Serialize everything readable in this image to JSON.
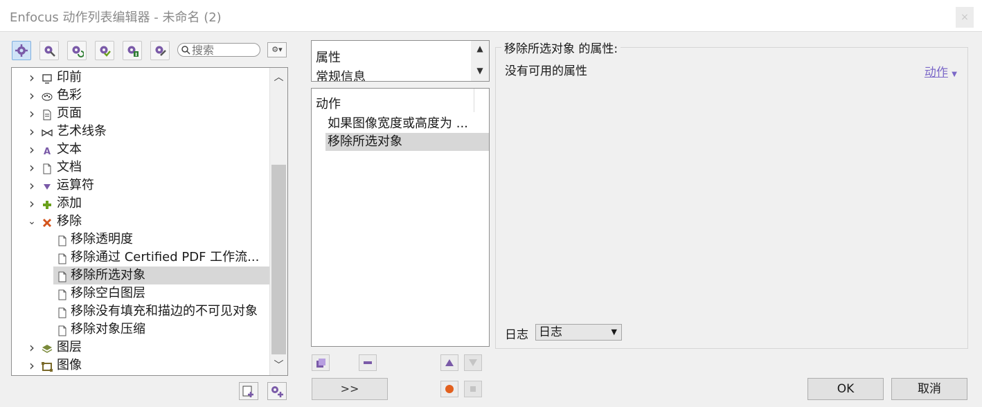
{
  "window": {
    "title": "Enfocus 动作列表编辑器 - 未命名 (2)",
    "close_glyph": "×"
  },
  "toolbar": {
    "tools": [
      "gear-icon",
      "gear-wrench-icon",
      "gear-refresh-icon",
      "gear-check-icon",
      "gear-info-icon",
      "gear-pencil-icon"
    ],
    "search_placeholder": "搜索",
    "gear_dropdown_label": "⚙▾"
  },
  "tree": {
    "items": [
      {
        "label": "印前",
        "icon": "monitor-icon",
        "expanded": false,
        "level": 0
      },
      {
        "label": "色彩",
        "icon": "palette-icon",
        "expanded": false,
        "level": 0
      },
      {
        "label": "页面",
        "icon": "page-icon",
        "expanded": false,
        "level": 0
      },
      {
        "label": "艺术线条",
        "icon": "bowtie-icon",
        "expanded": false,
        "level": 0
      },
      {
        "label": "文本",
        "icon": "letter-a-icon",
        "expanded": false,
        "level": 0
      },
      {
        "label": "文档",
        "icon": "document-icon",
        "expanded": false,
        "level": 0
      },
      {
        "label": "运算符",
        "icon": "operator-icon",
        "expanded": false,
        "level": 0
      },
      {
        "label": "添加",
        "icon": "plus-icon",
        "expanded": false,
        "level": 0
      },
      {
        "label": "移除",
        "icon": "remove-x-icon",
        "expanded": true,
        "level": 0
      },
      {
        "label": "移除透明度",
        "icon": "document-icon",
        "level": 1
      },
      {
        "label": "移除通过 Certified PDF 工作流...",
        "icon": "document-icon",
        "level": 1
      },
      {
        "label": "移除所选对象",
        "icon": "document-icon",
        "level": 1,
        "selected": true
      },
      {
        "label": "移除空白图层",
        "icon": "document-icon",
        "level": 1
      },
      {
        "label": "移除没有填充和描边的不可见对象",
        "icon": "document-icon",
        "level": 1
      },
      {
        "label": "移除对象压缩",
        "icon": "document-icon",
        "level": 1
      },
      {
        "label": "图层",
        "icon": "layers-icon",
        "expanded": false,
        "level": 0
      },
      {
        "label": "图像",
        "icon": "image-frame-icon",
        "expanded": false,
        "level": 0
      }
    ]
  },
  "list_top": {
    "items": [
      "属性",
      "常规信息"
    ]
  },
  "actions": {
    "header": "动作",
    "rows": [
      {
        "label": "如果图像宽度或高度为 ..."
      },
      {
        "label": "移除所选对象",
        "selected": true
      }
    ]
  },
  "middle_buttons": {
    "forward_label": ">>"
  },
  "properties": {
    "title": "移除所选对象 的属性:",
    "empty_text": "没有可用的属性",
    "action_link": "动作",
    "log_label": "日志",
    "log_value": "日志"
  },
  "dialog": {
    "ok_label": "OK",
    "cancel_label": "取消"
  },
  "colors": {
    "accent": "#7b68c8",
    "selection": "#d7d7d7",
    "gear_purple": "#7a5aa8"
  }
}
